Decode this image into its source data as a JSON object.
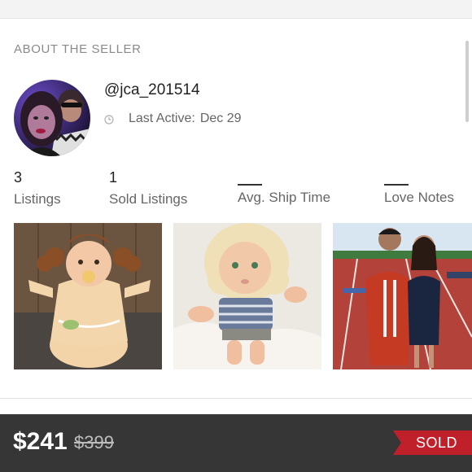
{
  "seller_section": {
    "title": "ABOUT THE SELLER",
    "username": "@jca_201514",
    "last_active_label": "Last Active:",
    "last_active_date": "Dec 29"
  },
  "stats": [
    {
      "value": "3",
      "label": "Listings"
    },
    {
      "value": "1",
      "label": "Sold Listings"
    },
    {
      "value": "",
      "label": "Avg. Ship Time"
    },
    {
      "value": "",
      "label": "Love Notes"
    }
  ],
  "listing_photos": [
    {
      "icon": "doll-with-brown-curly-hair-photo"
    },
    {
      "icon": "doll-with-blonde-hair-photo"
    },
    {
      "icon": "graduation-couple-photo"
    }
  ],
  "footer": {
    "price": "$241",
    "original_price": "$399",
    "status_badge": "SOLD"
  },
  "colors": {
    "bottom_bar": "#363636",
    "sold_ribbon": "#c0202a"
  }
}
